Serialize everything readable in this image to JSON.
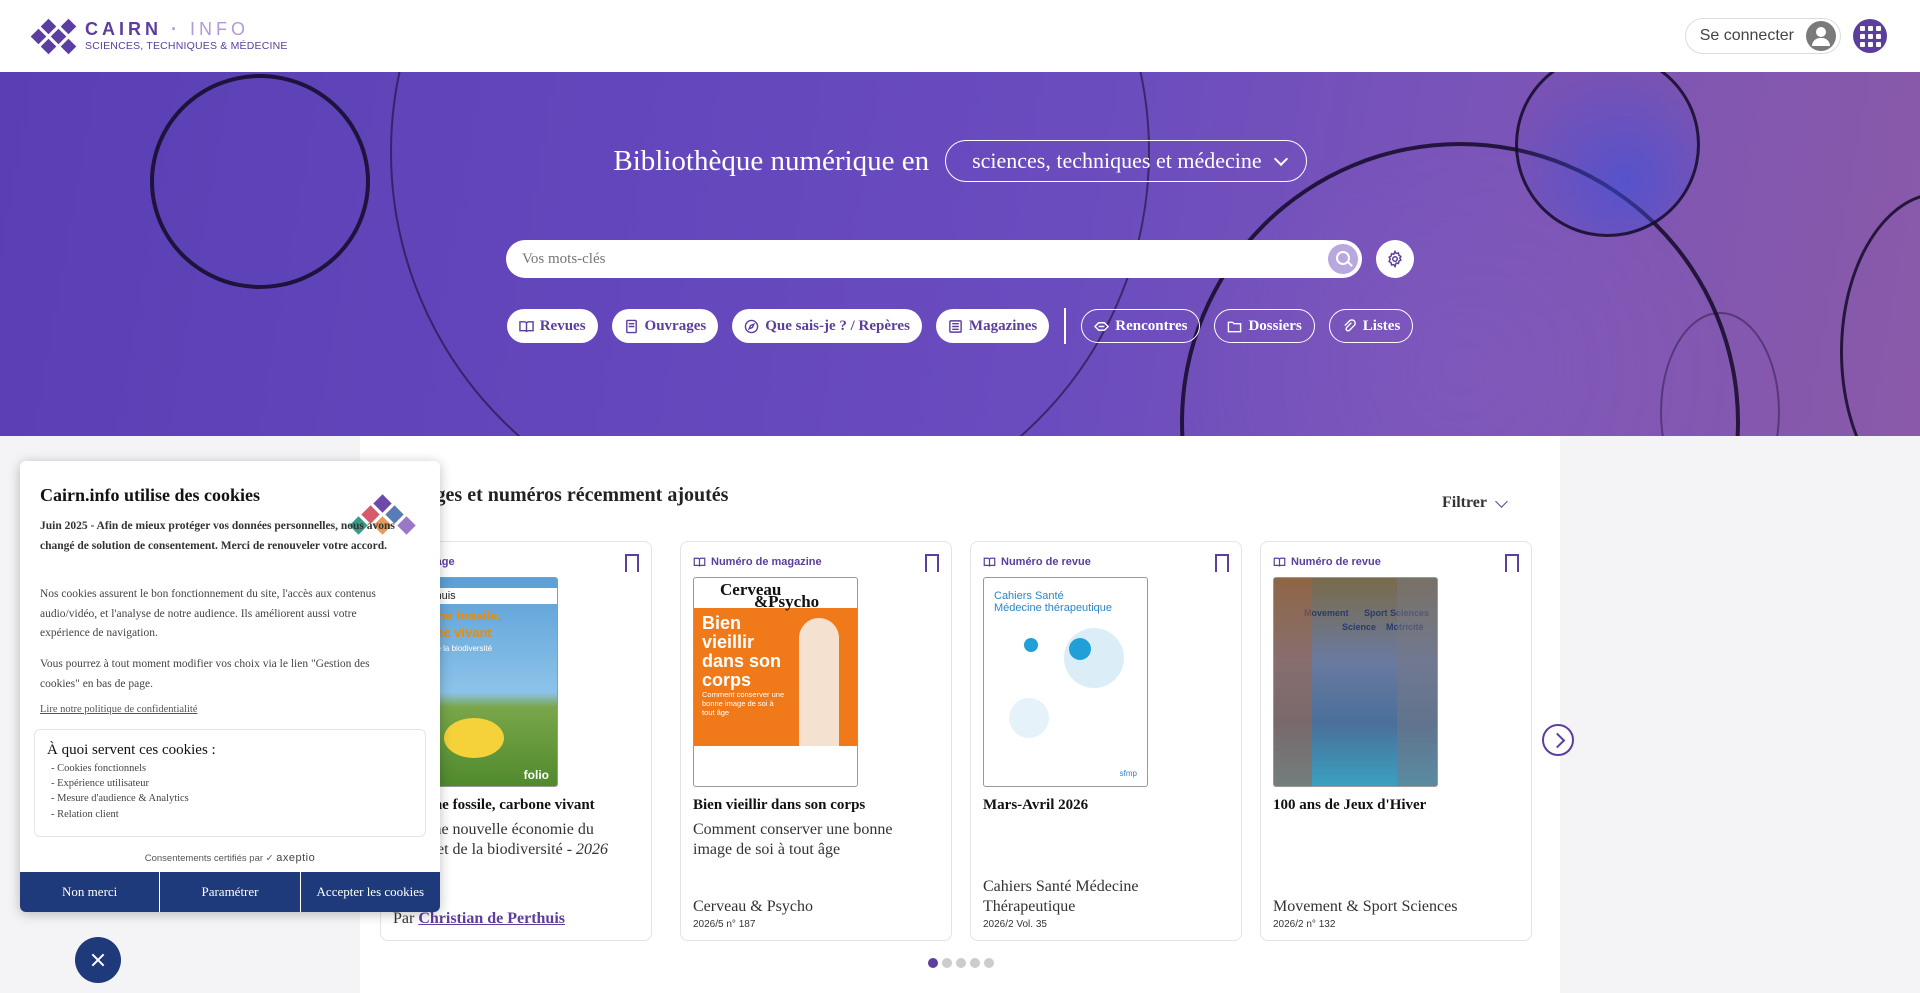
{
  "header": {
    "logo_title_main": "CAIRN",
    "logo_title_dot": "·",
    "logo_title_info": "INFO",
    "logo_subtitle": "SCIENCES, TECHNIQUES & MÉDECINE",
    "login_label": "Se connecter"
  },
  "hero": {
    "title": "Bibliothèque numérique en",
    "domain_selected": "sciences, techniques et médecine",
    "search_placeholder": "Vos mots-clés",
    "nav": [
      {
        "label": "Revues",
        "icon": "book-open-icon"
      },
      {
        "label": "Ouvrages",
        "icon": "book-icon"
      },
      {
        "label": "Que sais-je ? / Repères",
        "icon": "compass-icon"
      },
      {
        "label": "Magazines",
        "icon": "newspaper-icon"
      }
    ],
    "nav_secondary": [
      {
        "label": "Rencontres",
        "icon": "diamond-icon"
      },
      {
        "label": "Dossiers",
        "icon": "folder-icon"
      },
      {
        "label": "Listes",
        "icon": "clip-icon"
      }
    ]
  },
  "recent": {
    "title": "Ouvrages et numéros récemment ajoutés",
    "filter_label": "Filtrer",
    "cards": [
      {
        "type": "Ouvrage",
        "cover_lines": [
          "de Perthuis",
          "Carbone fossile,",
          "carbone vivant",
          "climat et de la biodiversité",
          "folio"
        ],
        "title": "Carbone fossile, carbone vivant",
        "subtitle": "Vers une nouvelle économie du climat et de la biodiversité - ",
        "year": "2026",
        "author_prefix": "Par ",
        "author": "Christian de Perthuis"
      },
      {
        "type": "Numéro de magazine",
        "cover_lines": [
          "Cerveau",
          "&Psycho",
          "Bien vieillir dans son corps",
          "Comment conserver une bonne image de soi à tout âge"
        ],
        "title": "Bien vieillir dans son corps",
        "subtitle": "Comment conserver une bonne image de soi à tout âge",
        "source": "Cerveau & Psycho",
        "issue": "2026/5 n° 187"
      },
      {
        "type": "Numéro de revue",
        "cover_lines": [
          "Cahiers Santé",
          "Médecine thérapeutique",
          "sfmp"
        ],
        "title": "Mars-Avril 2026",
        "source": "Cahiers Santé Médecine Thérapeutique",
        "issue": "2026/2 Vol. 35"
      },
      {
        "type": "Numéro de revue",
        "cover_lines": [
          "Movement",
          "Sport Sciences",
          "Science",
          "Motricité"
        ],
        "title": "100 ans de Jeux d'Hiver",
        "source": "Movement & Sport Sciences",
        "issue": "2026/2 n° 132"
      }
    ]
  },
  "cookie": {
    "title": "Cairn.info utilise des cookies",
    "lead": "Juin 2025 - Afin de mieux protéger vos données personnelles, nous avons changé de solution de consentement. Merci de renouveler votre accord.",
    "p2": "Nos cookies assurent le bon fonctionnement du site, l'accès aux contenus audio/vidéo, et l'analyse de notre audience. Ils améliorent aussi votre expérience de navigation.",
    "p3": "Vous pourrez à tout moment modifier vos choix via le lien \"Gestion des cookies\" en bas de page.",
    "policy_link": "Lire notre politique de confidentialité",
    "purpose_title": "À quoi servent ces cookies :",
    "purposes": [
      "Cookies fonctionnels",
      "Expérience utilisateur",
      "Mesure d'audience & Analytics",
      "Relation client"
    ],
    "certified_prefix": "Consentements certifiés par ",
    "certified_brand": "axeptio",
    "btn_refuse": "Non merci",
    "btn_settings": "Paramétrer",
    "btn_accept": "Accepter les cookies"
  },
  "colors": {
    "brand": "#5b3e9e",
    "cookie_button": "#1f3a7a"
  }
}
